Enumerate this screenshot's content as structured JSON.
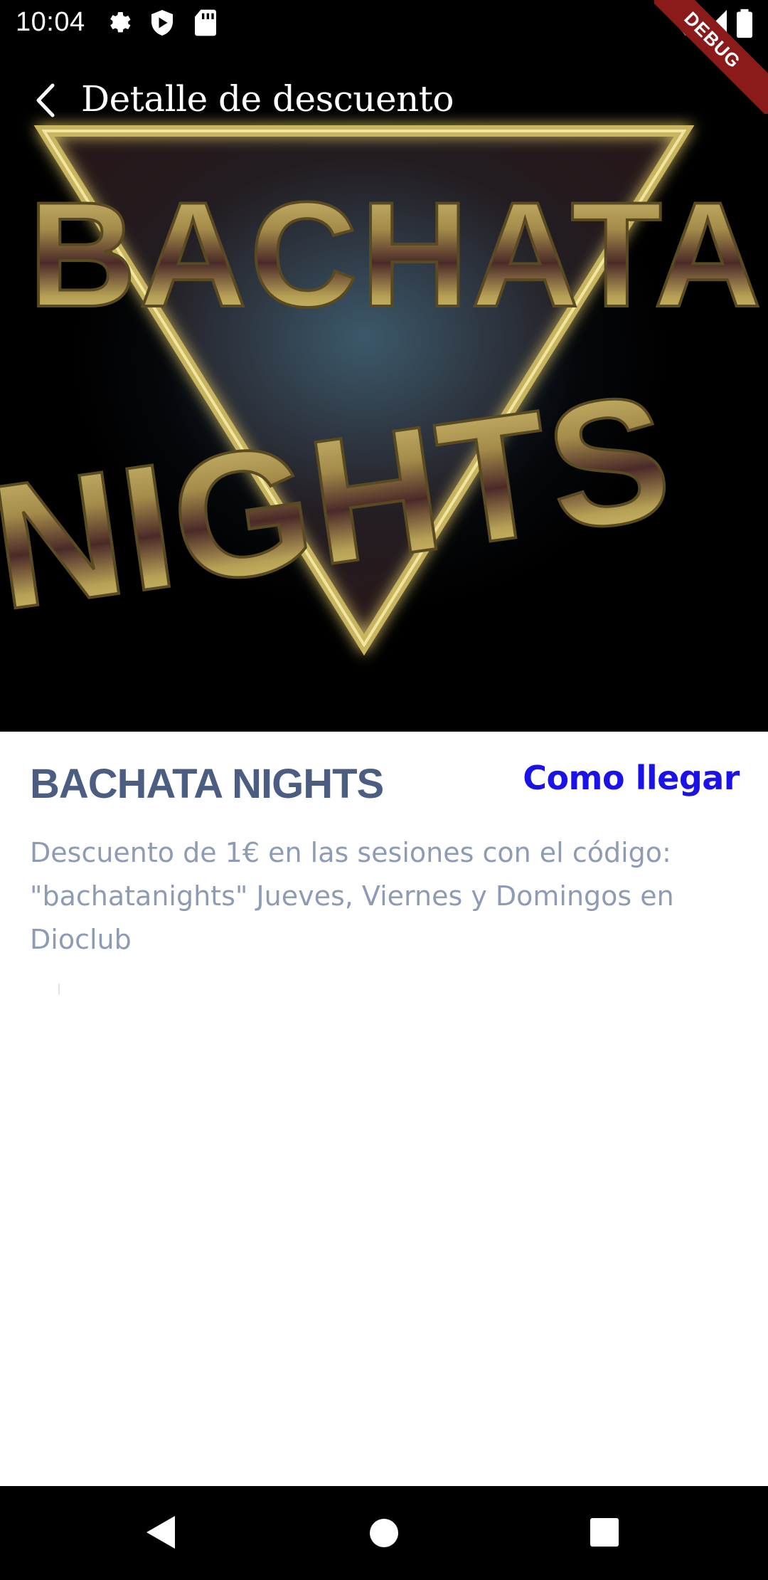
{
  "status_bar": {
    "time": "10:04",
    "icons": [
      "gear-icon",
      "shield-play-icon",
      "sd-card-icon",
      "wifi-icon",
      "signal-icon",
      "battery-icon"
    ]
  },
  "debug_banner": {
    "label": "DEBUG"
  },
  "app_bar": {
    "title": "Detalle de descuento",
    "back_icon": "chevron-left-icon"
  },
  "hero": {
    "logo_line1": "BACHATA",
    "logo_line2": "NIGHTS"
  },
  "discount": {
    "title": "BACHATA NIGHTS",
    "directions_label": "Como llegar",
    "description": "Descuento de 1€ en las sesiones con el código: \"bachatanights\" Jueves, Viernes y Domingos en Dioclub"
  },
  "nav_bar": {
    "icons": [
      "back-triangle-icon",
      "home-circle-icon",
      "recents-square-icon"
    ]
  },
  "colors": {
    "title": "#4b5e82",
    "link": "#1a12e6",
    "description": "#8e9bb5",
    "gold": "#c9b560",
    "debug": "#8b1a1a"
  }
}
